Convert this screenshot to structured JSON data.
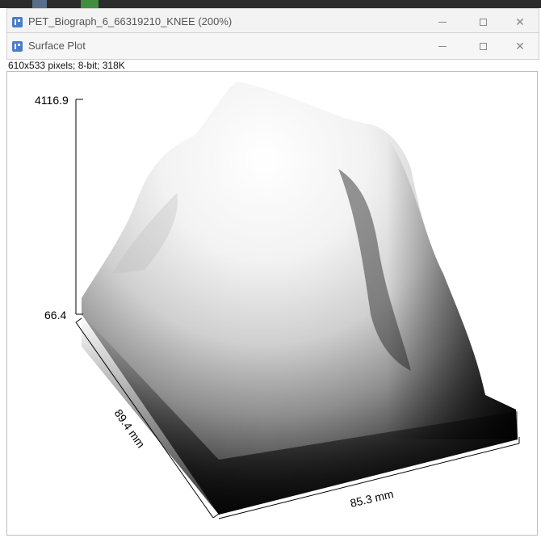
{
  "window_back": {
    "title": "PET_Biograph_6_66319210_KNEE (200%)"
  },
  "window_front": {
    "title": "Surface Plot",
    "info": "610x533 pixels; 8-bit; 318K"
  },
  "plot": {
    "z_max_label": "4116.9",
    "z_min_label": "66.4",
    "y_axis_label": "89.4 mm",
    "x_axis_label": "85.3 mm"
  },
  "colors": {
    "titlebar": "#f3f3f3",
    "icon": "#4a7cc7",
    "surface_dark": "#000000",
    "surface_light": "#ffffff"
  }
}
